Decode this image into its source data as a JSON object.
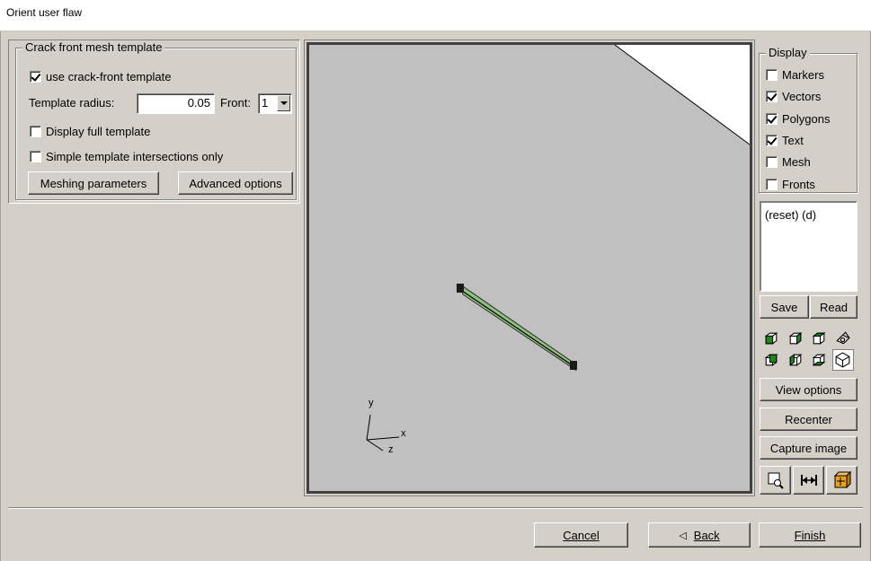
{
  "window": {
    "title": "Orient user flaw"
  },
  "template_group": {
    "legend": "Crack front mesh template",
    "use_template": {
      "label": "use crack-front template",
      "checked": true
    },
    "radius_label": "Template radius:",
    "radius_value": "0.05",
    "front_label": "Front:",
    "front_value": "1",
    "display_full": {
      "label": "Display full template",
      "checked": false
    },
    "simple_only": {
      "label": "Simple template intersections only",
      "checked": false
    },
    "meshing_button": "Meshing parameters",
    "advanced_button": "Advanced options"
  },
  "display_group": {
    "legend": "Display",
    "items": [
      {
        "label": "Markers",
        "checked": false
      },
      {
        "label": "Vectors",
        "checked": true
      },
      {
        "label": "Polygons",
        "checked": true
      },
      {
        "label": "Text",
        "checked": true
      },
      {
        "label": "Mesh",
        "checked": false
      },
      {
        "label": "Fronts",
        "checked": false
      }
    ]
  },
  "script_box": {
    "text": "(reset) (d)"
  },
  "side_buttons": {
    "save": "Save",
    "read": "Read",
    "view_options": "View options",
    "recenter": "Recenter",
    "capture": "Capture image"
  },
  "view_icons": {
    "row1": [
      "view-front-icon",
      "view-right-icon",
      "view-top-icon",
      "view-iso-wire-icon"
    ],
    "row2": [
      "view-back-icon",
      "view-left-icon",
      "view-bottom-icon",
      "view-iso-icon"
    ],
    "tools": [
      "zoom-icon",
      "fit-width-icon",
      "bounding-box-icon"
    ]
  },
  "axes": {
    "x": "x",
    "y": "y",
    "z": "z"
  },
  "footer": {
    "cancel": "Cancel",
    "back": "Back",
    "finish": "Finish"
  },
  "colors": {
    "crack_fill": "#90c080",
    "viewport_bg": "#c0c0c0",
    "cube_green": "#1a8a1a"
  }
}
